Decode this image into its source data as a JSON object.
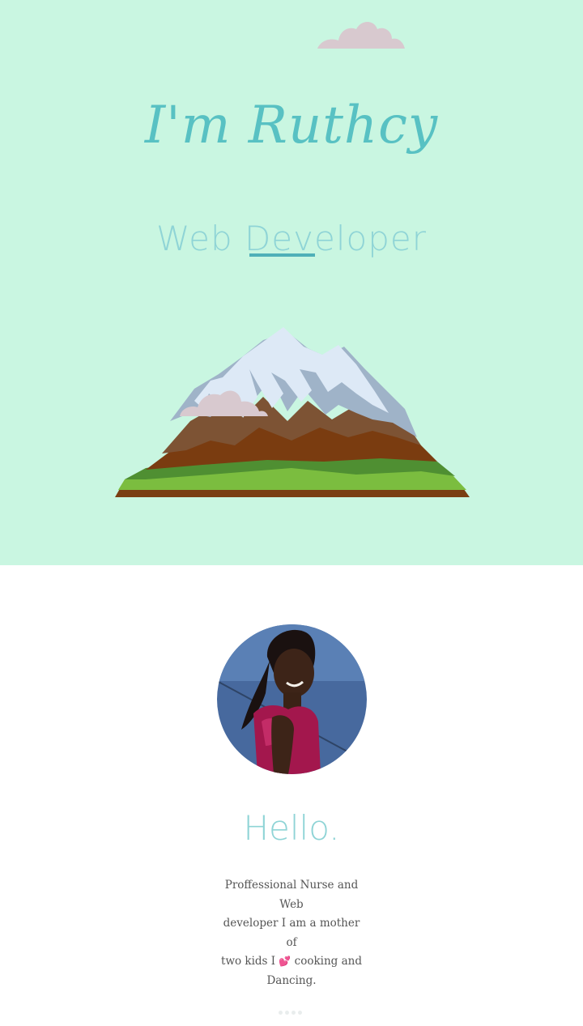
{
  "hero": {
    "title": "I'm Ruthcy",
    "subtitle": "Web Developer",
    "subtitle_typed_part": "Deve",
    "background_color": "#c9f6e1",
    "accent_color": "#58c1c3"
  },
  "about": {
    "greeting": "Hello.",
    "bio_line1": "Proffessional Nurse and Web",
    "bio_line2": "developer I am a mother of",
    "bio_line3_before": "two kids I ",
    "bio_heart": "💕",
    "bio_line3_after": " cooking and",
    "bio_line4": "Dancing."
  },
  "icons": {
    "top_cloud": "cloud-icon",
    "mountain": "mountain-illustration",
    "avatar": "profile-photo",
    "scroll_indicator": "dots-indicator"
  }
}
